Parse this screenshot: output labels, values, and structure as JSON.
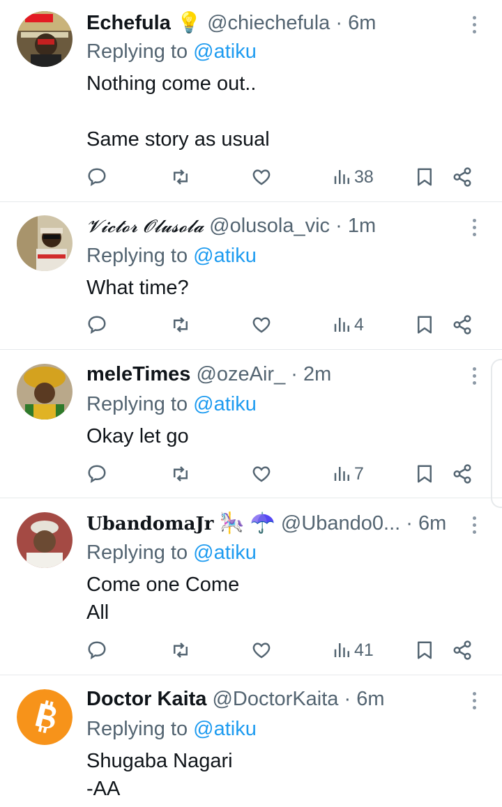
{
  "tweets": [
    {
      "name": "Echefula",
      "emoji": "💡",
      "handle": "@chiechefula",
      "sep": "·",
      "time": "6m",
      "reply_prefix": "Replying to",
      "reply_to": "@atiku",
      "text": "Nothing come out..\n\nSame story as usual",
      "views": "38"
    },
    {
      "name": "𝓥𝓲𝓬𝓽𝓸𝓻 𝓞𝓵𝓾𝓼𝓸𝓵𝓪",
      "emoji": "",
      "handle": "@olusola_vic",
      "sep": "·",
      "time": "1m",
      "reply_prefix": "Replying to",
      "reply_to": "@atiku",
      "text": "What time?",
      "views": "4"
    },
    {
      "name": "meleTimes",
      "emoji": "",
      "handle": "@ozeAir_",
      "sep": "·",
      "time": "2m",
      "reply_prefix": "Replying to",
      "reply_to": "@atiku",
      "text": "Okay let go",
      "views": "7"
    },
    {
      "name": "𝐔𝐛𝐚𝐧𝐝𝐨𝐦𝐚𝐉𝐫",
      "emoji": "🎠 ☂️",
      "handle": "@Ubando0...",
      "sep": "·",
      "time": "6m",
      "reply_prefix": "Replying to",
      "reply_to": "@atiku",
      "text": "Come one Come\nAll",
      "views": "41"
    },
    {
      "name": "Doctor Kaita",
      "emoji": "",
      "handle": "@DoctorKaita",
      "sep": "·",
      "time": "6m",
      "reply_prefix": "Replying to",
      "reply_to": "@atiku",
      "text": "Shugaba Nagari\n-AA",
      "views": ""
    }
  ],
  "colors": {
    "link": "#1d9bf0",
    "muted": "#536471",
    "text": "#0f1419",
    "divider": "#e6e9eb",
    "bitcoin": "#f7931a"
  },
  "icons": [
    "reply-icon",
    "retweet-icon",
    "like-icon",
    "views-icon",
    "bookmark-icon",
    "share-icon",
    "more-icon"
  ]
}
